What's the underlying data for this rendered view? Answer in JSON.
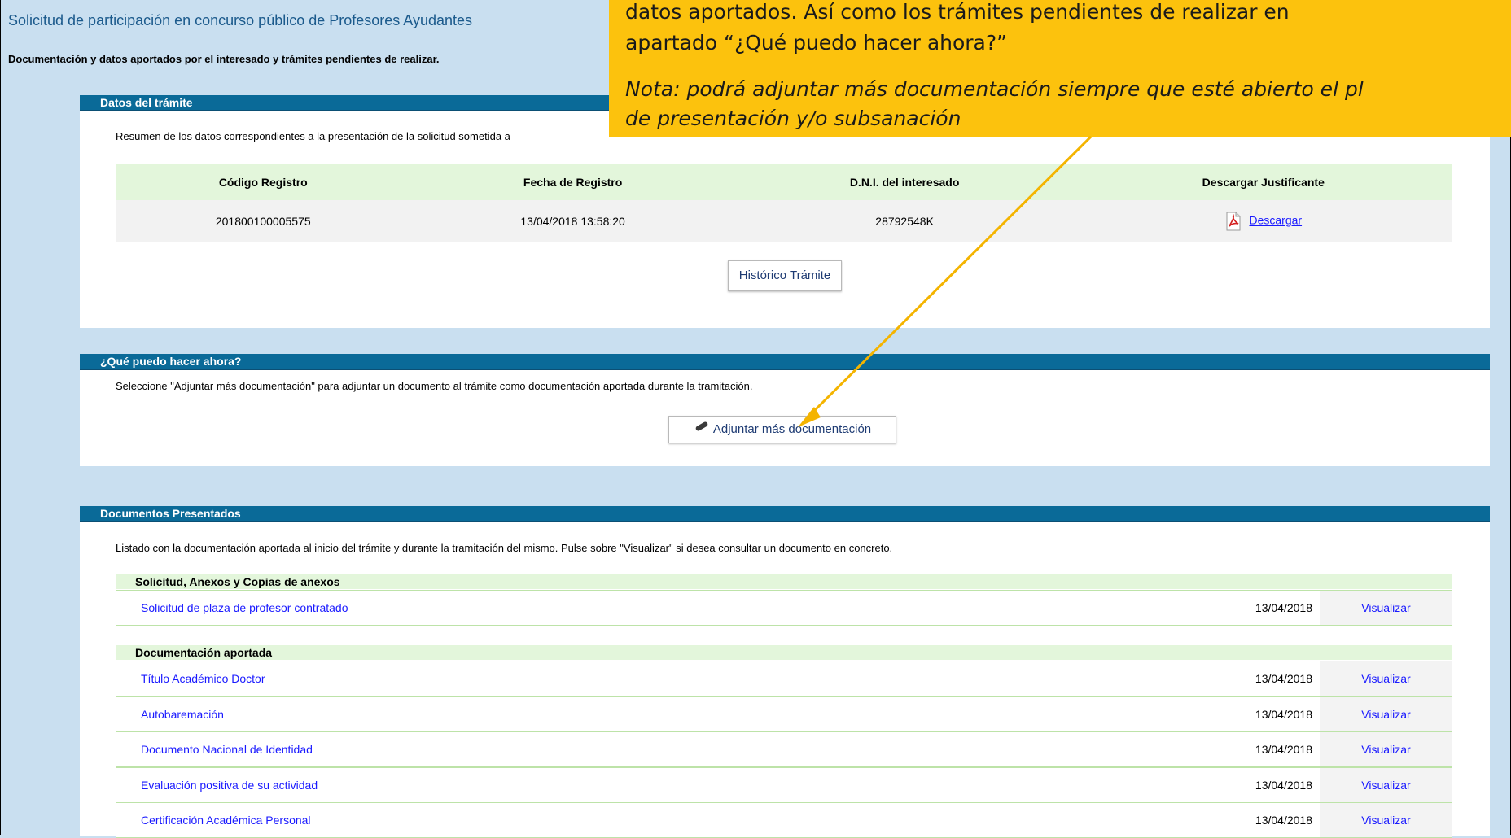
{
  "page": {
    "title": "Solicitud de participación en concurso público de Profesores Ayudantes",
    "subtitle": "Documentación y datos aportados por el interesado y trámites pendientes de realizar."
  },
  "datos": {
    "header": "Datos del trámite",
    "intro": "Resumen de los datos correspondientes a la presentación de la solicitud sometida a",
    "columns": [
      "Código Registro",
      "Fecha de Registro",
      "D.N.I. del interesado",
      "Descargar Justificante"
    ],
    "row": {
      "codigo": "201800100005575",
      "fecha": "13/04/2018 13:58:20",
      "dni": "28792548K",
      "descargar": "Descargar"
    },
    "historico_button": "Histórico Trámite"
  },
  "que_hacer": {
    "header": "¿Qué puedo hacer ahora?",
    "intro": "Seleccione \"Adjuntar más documentación\" para adjuntar un documento al trámite como documentación aportada durante la tramitación.",
    "adjuntar_button": "Adjuntar más documentación"
  },
  "documentos": {
    "header": "Documentos Presentados",
    "intro": "Listado con la documentación aportada al inicio del trámite y durante la tramitación del mismo. Pulse sobre \"Visualizar\" si desea consultar un documento en concreto.",
    "groups": [
      {
        "title": "Solicitud, Anexos y Copias de anexos",
        "items": [
          {
            "name": "Solicitud de plaza de profesor contratado",
            "date": "13/04/2018",
            "action": "Visualizar"
          }
        ]
      },
      {
        "title": "Documentación aportada",
        "items": [
          {
            "name": "Título Académico Doctor",
            "date": "13/04/2018",
            "action": "Visualizar"
          },
          {
            "name": "Autobaremación",
            "date": "13/04/2018",
            "action": "Visualizar"
          },
          {
            "name": "Documento Nacional de Identidad",
            "date": "13/04/2018",
            "action": "Visualizar"
          },
          {
            "name": "Evaluación positiva de su actividad",
            "date": "13/04/2018",
            "action": "Visualizar"
          },
          {
            "name": "Certificación Académica Personal",
            "date": "13/04/2018",
            "action": "Visualizar"
          }
        ]
      }
    ]
  },
  "callout": {
    "line1": "datos aportados. Así como los trámites pendientes de realizar en",
    "line2": "apartado “¿Qué puedo hacer ahora?”",
    "note1": "Nota: podrá adjuntar más documentación siempre que esté abierto el pl",
    "note2": "de presentación y/o subsanación"
  },
  "colors": {
    "background": "#c9dff0",
    "header_bar": "#0a6a98",
    "table_header": "#e3f6db",
    "callout": "#fcc20d",
    "link": "#1a1aff"
  }
}
